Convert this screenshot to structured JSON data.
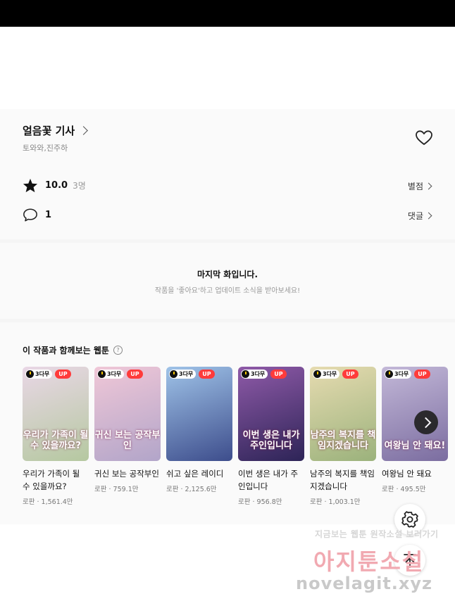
{
  "work": {
    "title": "얼음꽃 기사",
    "authors": "토와와,진주하",
    "rating": "10.0",
    "rating_count": "3명",
    "rate_link": "별점",
    "comment_count": "1",
    "comment_link": "댓글"
  },
  "end_notice": {
    "title": "마지막 화입니다.",
    "subtitle": "작품을 '좋아요'하고 업데이트 소식을 받아보세요!"
  },
  "recommend": {
    "heading": "이 작품과 함께보는 웹툰",
    "wait_badge": "3다무",
    "up_badge": "UP",
    "items": [
      {
        "title": "우리가 가족이 될 수 있을까요?",
        "meta": "로판 · 1,561.4만",
        "cover": "우리가 가족이 될 수 있을까요?",
        "bg": [
          "#e9d7e6",
          "#b5c8a0"
        ]
      },
      {
        "title": "귀신 보는 공작부인",
        "meta": "로판 · 759.1만",
        "cover": "귀신 보는 공작부인",
        "bg": [
          "#f0c7d7",
          "#b2a5c9"
        ]
      },
      {
        "title": "쉬고 싶은 레이디",
        "meta": "로판 · 2,125.6만",
        "cover": "",
        "bg": [
          "#9fc3e8",
          "#3d4d8c"
        ]
      },
      {
        "title": "이번 생은 내가 주인입니다",
        "meta": "로판 · 956.8만",
        "cover": "이번 생은 내가 주인입니다",
        "bg": [
          "#8f5aa8",
          "#2d2457"
        ]
      },
      {
        "title": "남주의 복지를 책임지겠습니다",
        "meta": "로판 · 1,003.1만",
        "cover": "남주의 복지를 책임지겠습니다",
        "bg": [
          "#e6dbb0",
          "#9bb27c"
        ]
      },
      {
        "title": "여왕님 안 돼요",
        "meta": "로판 · 495.5만",
        "cover": "여왕님 안 돼요!",
        "bg": [
          "#c3b8d8",
          "#7b6da0"
        ]
      }
    ]
  },
  "watermark": {
    "line1": "지금보는 웹툰 원작소설 보러가기",
    "line2": "아지툰소설",
    "line3": "novelagit.xyz"
  },
  "icons": [
    "heart-icon",
    "star-icon",
    "comment-icon",
    "help-icon",
    "clock-icon",
    "chevron-right-icon",
    "settings-icon",
    "arrow-up-icon"
  ]
}
